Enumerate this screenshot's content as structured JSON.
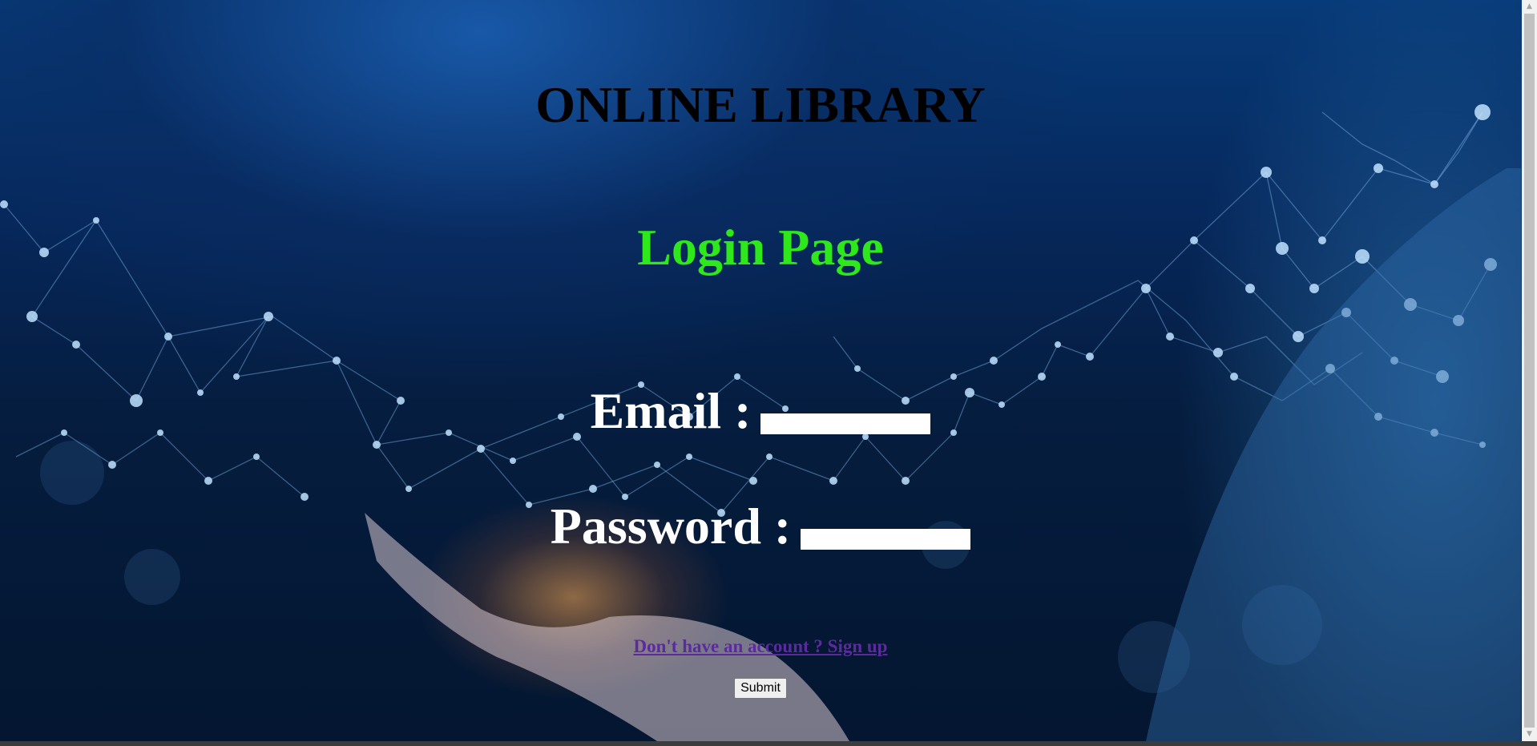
{
  "header": {
    "site_title": "ONLINE LIBRARY",
    "page_title": "Login Page"
  },
  "form": {
    "email_label": "Email :",
    "email_value": "",
    "password_label": "Password :",
    "password_value": "",
    "signup_link_text": "Don't have an account ? Sign up",
    "submit_label": "Submit"
  },
  "colors": {
    "site_title": "#000000",
    "page_title": "#2fe81c",
    "field_label": "#ffffff",
    "link": "#5b2b9e",
    "background_dark": "#041630",
    "background_accent": "#0a4a90"
  },
  "icons": {
    "scroll_up": "scroll-up-arrow-icon",
    "scroll_down": "scroll-down-arrow-icon"
  }
}
